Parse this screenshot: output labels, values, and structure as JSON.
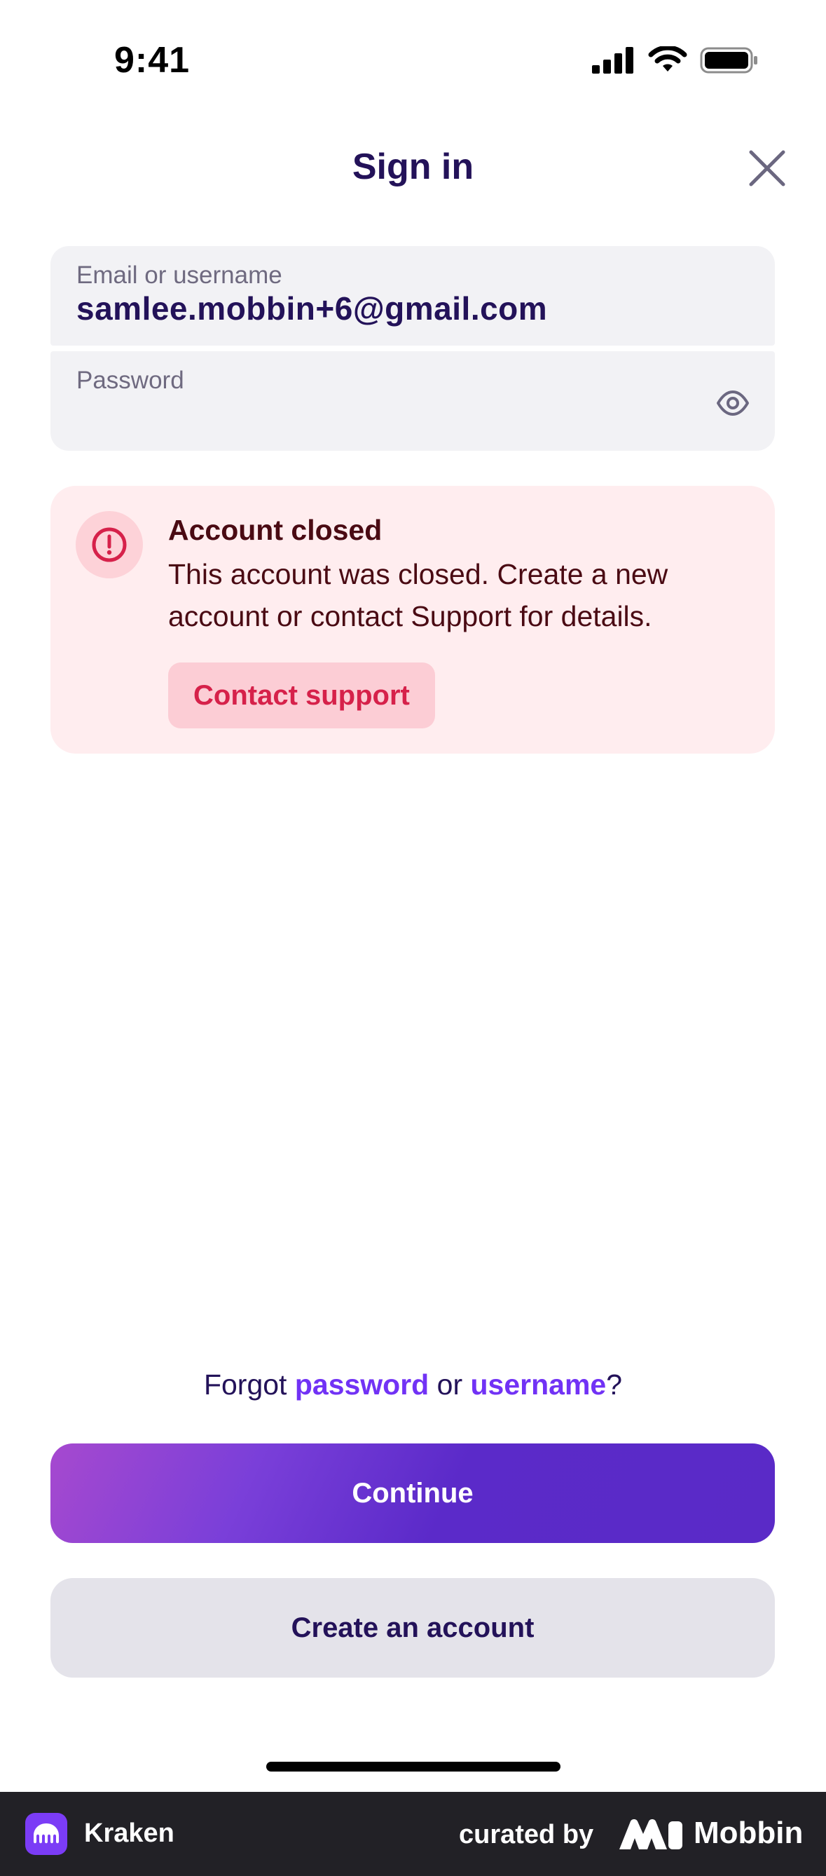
{
  "status_bar": {
    "time": "9:41"
  },
  "header": {
    "title": "Sign in",
    "close_icon": "close-icon"
  },
  "form": {
    "email": {
      "label": "Email or username",
      "value": "samlee.mobbin+6@gmail.com"
    },
    "password": {
      "label": "Password",
      "value": "",
      "toggle_icon": "eye-icon"
    }
  },
  "alert": {
    "icon": "exclamation-circle-icon",
    "title": "Account closed",
    "message": "This account was closed. Create a new account or contact Support for details.",
    "button_label": "Contact support"
  },
  "forgot": {
    "prefix": "Forgot",
    "password_link": "password",
    "joiner": "or",
    "username_link": "username",
    "suffix": "?"
  },
  "actions": {
    "continue_label": "Continue",
    "create_label": "Create an account"
  },
  "footer": {
    "app_name": "Kraken",
    "curated_by": "curated by",
    "brand": "Mobbin"
  },
  "colors": {
    "accent": "#7132f5",
    "title_text": "#231259",
    "alert_bg": "#ffedef",
    "alert_text": "#4a0a13",
    "support_text": "#d6214a"
  }
}
